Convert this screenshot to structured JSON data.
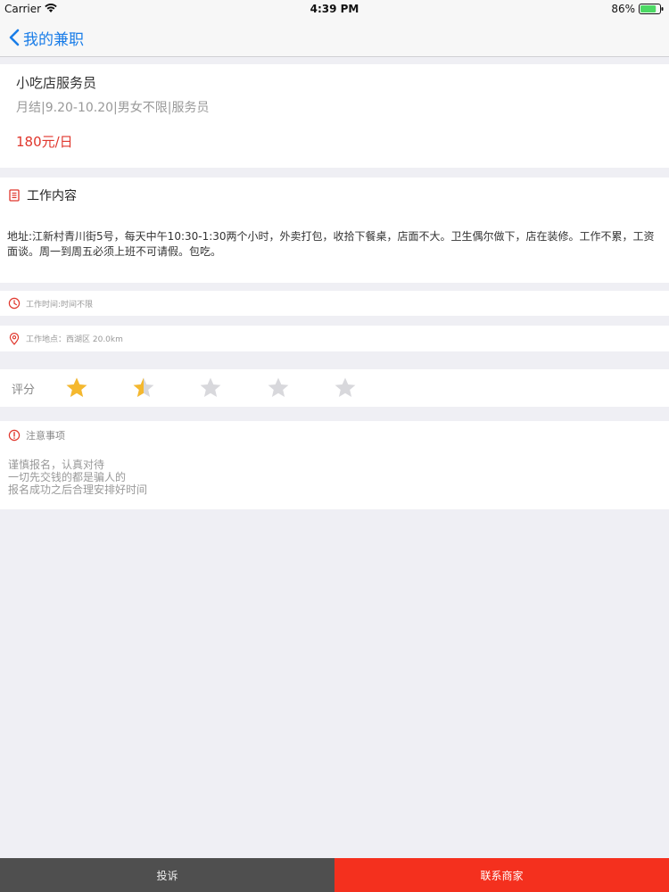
{
  "status_bar": {
    "carrier": "Carrier",
    "time": "4:39 PM",
    "battery": "86%",
    "battery_level": 0.86,
    "battery_color": "#4cd964"
  },
  "nav": {
    "back_icon": "chevron-left-icon",
    "title": "我的兼职",
    "title_color": "#1a7de8"
  },
  "job": {
    "title": "小吃店服务员",
    "meta": "月结|9.20-10.20|男女不限|服务员",
    "pay": "180元/日",
    "pay_color": "#e0362c"
  },
  "content": {
    "icon": "document-icon",
    "heading": "工作内容",
    "body": "地址:江新村青川街5号，每天中午10:30-1:30两个小时，外卖打包，收拾下餐桌，店面不大。卫生偶尔做下，店在装修。工作不累，工资面谈。周一到周五必须上班不可请假。包吃。"
  },
  "work_time": {
    "icon": "clock-icon",
    "text": "工作时间:时间不限"
  },
  "work_location": {
    "icon": "location-pin-icon",
    "text": "工作地点：西湖区 20.0km"
  },
  "rating": {
    "label": "评分",
    "value": 1.5,
    "max": 5,
    "filled_color": "#f5b82e",
    "empty_color": "#d8d8dc"
  },
  "notes": {
    "icon": "alert-circle-icon",
    "heading": "注意事项",
    "lines": [
      "谨慎报名，认真对待",
      "一切先交钱的都是骗人的",
      "报名成功之后合理安排好时间"
    ]
  },
  "bottom": {
    "complain_label": "投诉",
    "contact_label": "联系商家",
    "contact_color": "#f4301e"
  }
}
